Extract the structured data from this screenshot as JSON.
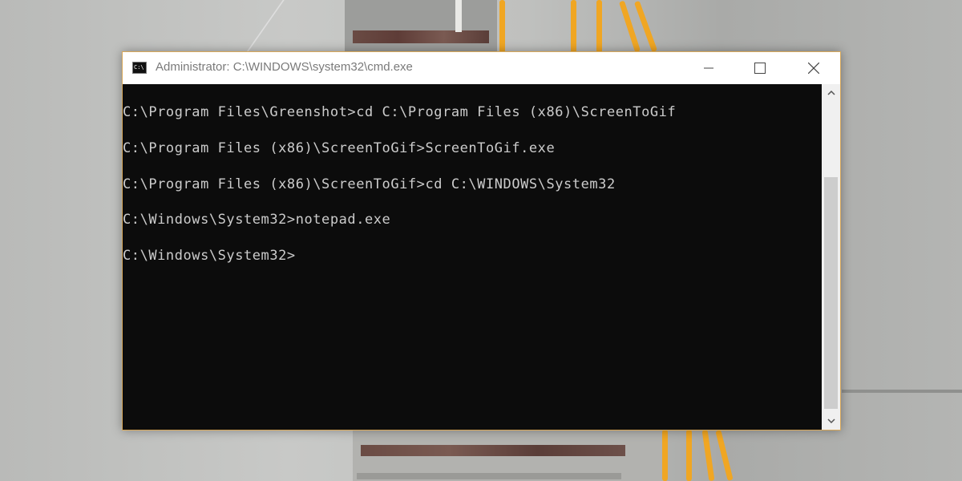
{
  "window": {
    "title": "Administrator: C:\\WINDOWS\\system32\\cmd.exe",
    "icon_label": "C:\\"
  },
  "console": {
    "lines": [
      "C:\\Program Files\\Greenshot>cd C:\\Program Files (x86)\\ScreenToGif",
      "C:\\Program Files (x86)\\ScreenToGif>ScreenToGif.exe",
      "C:\\Program Files (x86)\\ScreenToGif>cd C:\\WINDOWS\\System32",
      "C:\\Windows\\System32>notepad.exe",
      "C:\\Windows\\System32>"
    ]
  },
  "icons": {
    "minimize": "minimize-icon",
    "maximize": "maximize-icon",
    "close": "close-icon",
    "scroll_up": "chevron-up-icon",
    "scroll_down": "chevron-down-icon"
  },
  "colors": {
    "console_background": "#0c0c0c",
    "console_text": "#cccccc",
    "window_border": "#d8a85a"
  }
}
